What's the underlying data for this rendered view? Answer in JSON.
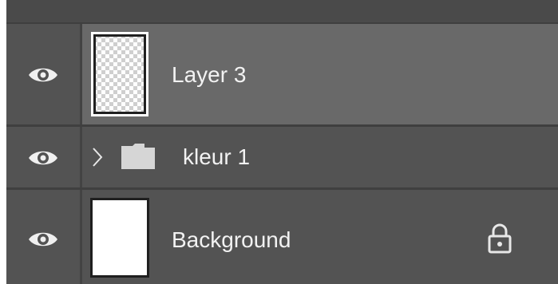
{
  "layers_panel": {
    "layers": [
      {
        "name": "Layer 3",
        "visible": true,
        "selected": true,
        "thumbnail": "transparent"
      },
      {
        "name": "kleur 1",
        "visible": true,
        "selected": false,
        "type": "group",
        "expanded": false
      },
      {
        "name": "Background",
        "visible": true,
        "selected": false,
        "locked": true,
        "thumbnail": "white"
      }
    ]
  },
  "icons": {
    "visibility": "eye-icon",
    "expand": "chevron-right-icon",
    "group": "folder-icon",
    "lock": "lock-icon"
  },
  "colors": {
    "panel_bg": "#535353",
    "selected_row_bg": "#696969",
    "divider": "#3f3f3f",
    "text": "#f2f2f2"
  }
}
